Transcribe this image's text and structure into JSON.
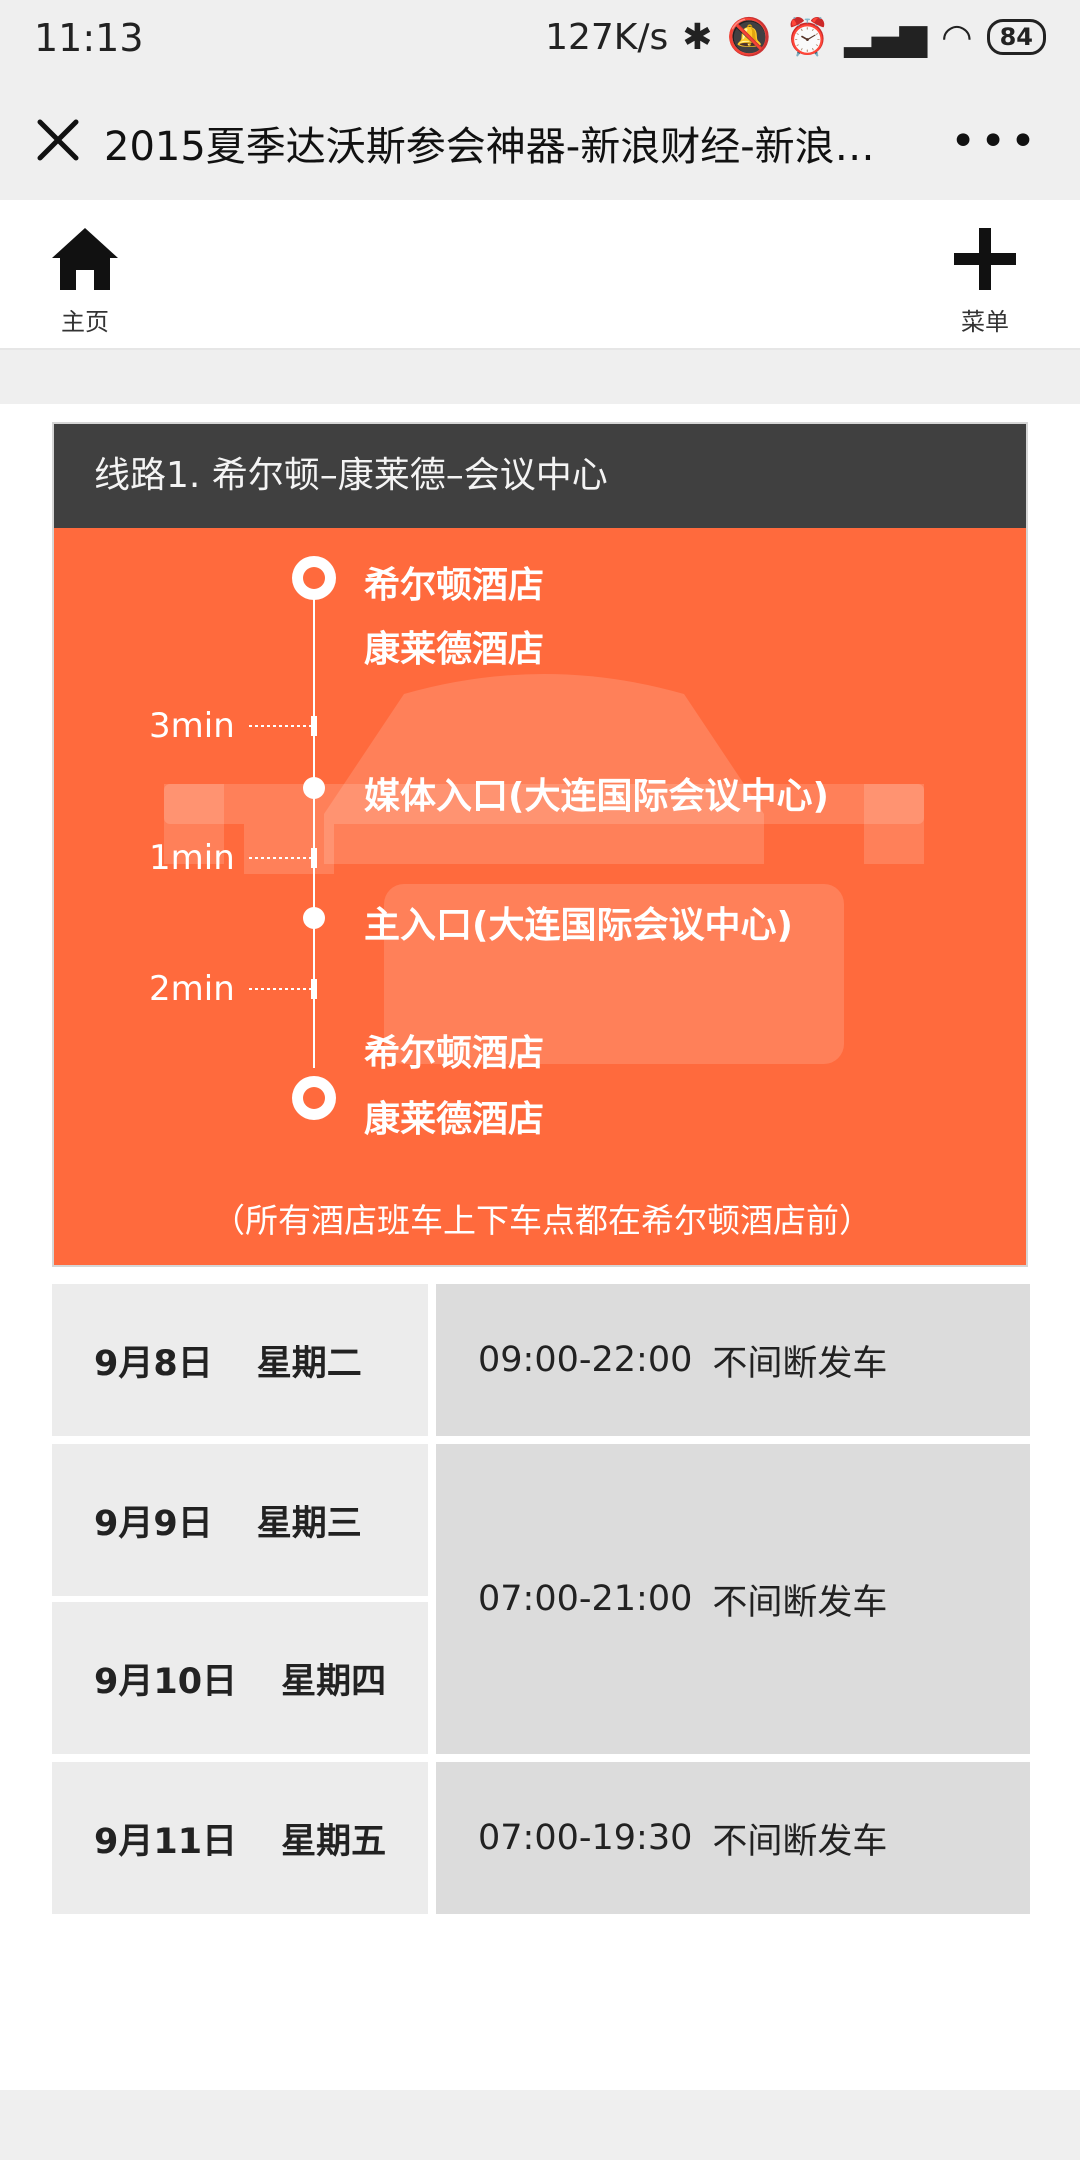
{
  "status": {
    "time": "11:13",
    "net_speed": "127K/s",
    "battery": "84"
  },
  "browser": {
    "title": "2015夏季达沃斯参会神器-新浪财经-新浪…"
  },
  "nav": {
    "home_label": "主页",
    "menu_label": "菜单"
  },
  "route": {
    "title": "线路1. 希尔顿–康莱德–会议中心",
    "stops": [
      {
        "name": "希尔顿酒店"
      },
      {
        "name": "康莱德酒店"
      },
      {
        "name": "媒体入口(大连国际会议中心)"
      },
      {
        "name": "主入口(大连国际会议中心)"
      },
      {
        "name": "希尔顿酒店"
      },
      {
        "name": "康莱德酒店"
      }
    ],
    "durations": [
      "3min",
      "1min",
      "2min"
    ],
    "note": "（所有酒店班车上下车点都在希尔顿酒店前）"
  },
  "schedule": {
    "rows": [
      {
        "date": "9月8日",
        "weekday": "星期二"
      },
      {
        "date": "9月9日",
        "weekday": "星期三"
      },
      {
        "date": "9月10日",
        "weekday": "星期四"
      },
      {
        "date": "9月11日",
        "weekday": "星期五"
      }
    ],
    "times": [
      {
        "hours": "09:00-22:00",
        "desc": "不间断发车"
      },
      {
        "hours": "07:00-21:00",
        "desc": "不间断发车"
      },
      {
        "hours": "07:00-19:30",
        "desc": "不间断发车"
      }
    ]
  },
  "colors": {
    "accent": "#ff6a3d",
    "header": "#404040"
  }
}
